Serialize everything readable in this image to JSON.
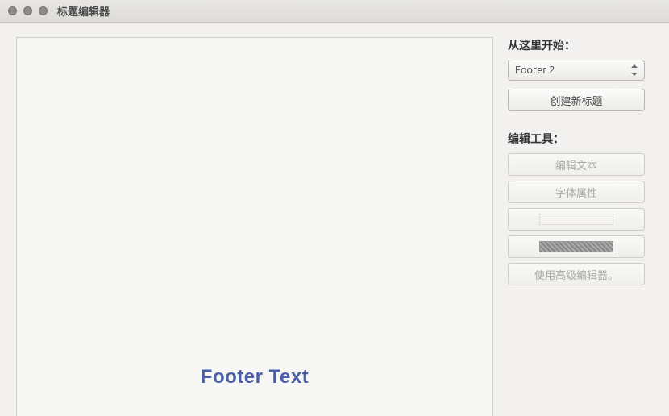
{
  "window": {
    "title": "标题编辑器"
  },
  "canvas": {
    "footer_label": "Footer Text"
  },
  "sidebar": {
    "start_section_label": "从这里开始：",
    "dropdown_value": "Footer 2",
    "create_button_label": "创建新标题",
    "tools_section_label": "编辑工具：",
    "edit_text_label": "编辑文本",
    "font_properties_label": "字体属性",
    "advanced_editor_label": "使用高级编辑器。"
  }
}
